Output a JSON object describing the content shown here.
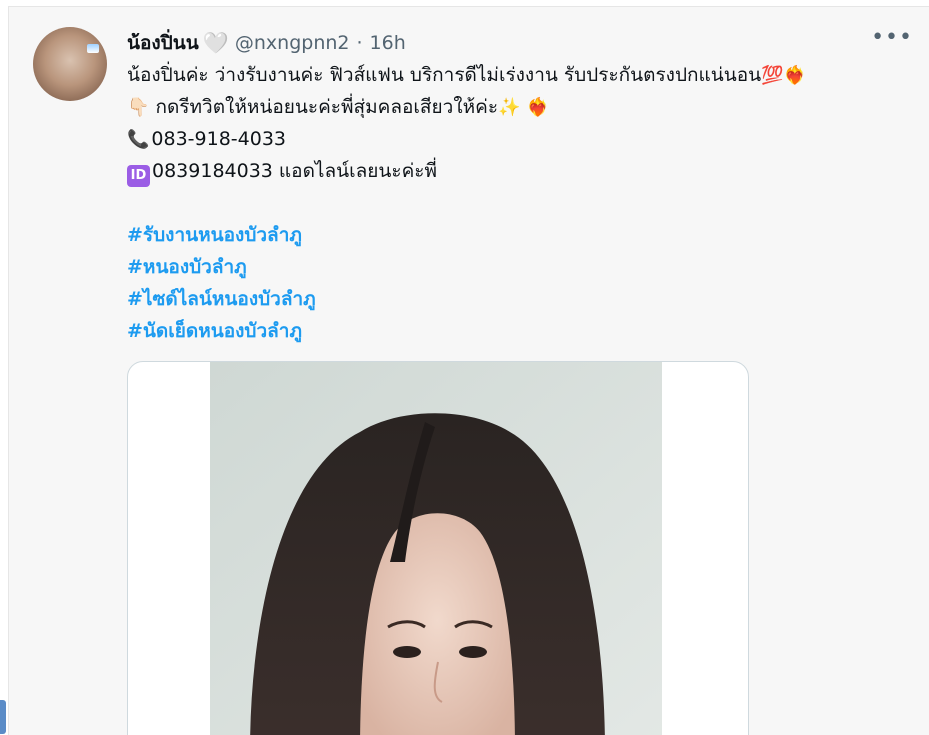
{
  "tweet": {
    "display_name": "น้องปิ่นน",
    "name_emoji": "🤍",
    "handle": "@nxngpnn2",
    "separator": "·",
    "timestamp": "16h",
    "more_label": "•••",
    "lines": {
      "l1_text": "น้องปิ่นค่ะ ว่างรับงานค่ะ ฟิวส์แฟน บริการดีไม่เร่งงาน รับประกันตรงปกแน่นอน",
      "l1_emoji_100": "💯",
      "l1_emoji_heart": "❤️‍🔥",
      "l2_emoji_point": "👇🏻",
      "l2_text": "กดรีทวิตให้หน่อยนะค่ะพี่สุ่มคลอเสียวให้ค่ะ",
      "l2_emoji_sparkle": "✨",
      "l2_emoji_heart": "❤️‍🔥",
      "phone_icon": "📞",
      "phone": "083-918-4033",
      "id_icon": "ID",
      "line_id": "0839184033 แอดไลน์เลยนะค่ะพี่"
    },
    "hashtags": [
      "#รับงานหนองบัวลำภู",
      "#หนองบัวลำภู",
      "#ไซด์ไลน์หนองบัวลำภู",
      "#นัดเย็ดหนองบัวลำภู"
    ]
  },
  "colors": {
    "link": "#1d9bf0",
    "secondary_text": "#536471",
    "background": "#f7f7f7"
  }
}
